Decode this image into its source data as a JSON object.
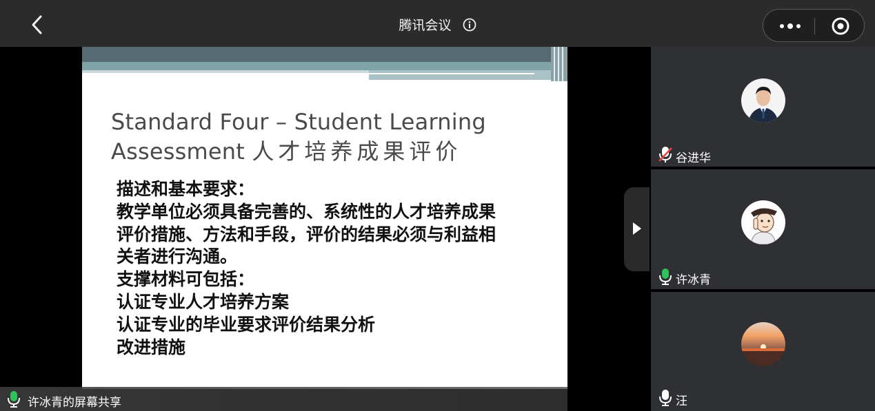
{
  "header": {
    "back_icon": "chevron-left-icon",
    "title": "腾讯会议",
    "info_icon": "info-icon",
    "more_icon": "more-dots-icon",
    "close_icon": "close-circle-icon"
  },
  "slide": {
    "title_line1": "Standard Four –  Student Learning",
    "title_line2_en": "Assessment ",
    "title_line2_cn": "人才培养成果评价",
    "body_lines": [
      "描述和基本要求：",
      "教学单位必须具备完善的、系统性的人才培养成果",
      "评价措施、方法和手段，评价的结果必须与利益相",
      "关者进行沟通。",
      "支撑材料可包括：",
      "认证专业人才培养方案",
      "认证专业的毕业要求评价结果分析",
      "改进措施"
    ]
  },
  "share": {
    "label": "许冰青的屏幕共享",
    "mic_icon": "microphone-icon"
  },
  "expand_icon": "play-right-icon",
  "participants": [
    {
      "name": "谷进华",
      "mic_state": "muted",
      "mic_icon": "microphone-muted-icon",
      "avatar": "avatar-man-suit"
    },
    {
      "name": "许冰青",
      "mic_state": "on",
      "mic_icon": "microphone-active-icon",
      "avatar": "avatar-cartoon"
    },
    {
      "name": "汪",
      "mic_state": "on",
      "mic_icon": "microphone-icon",
      "avatar": "avatar-sunset"
    }
  ],
  "colors": {
    "topbar": "#2b2b2b",
    "tile": "#2e3033",
    "mic_active": "#2fc25b",
    "mic_muted": "#e64545",
    "slide_teal": "#5b8a8c"
  }
}
